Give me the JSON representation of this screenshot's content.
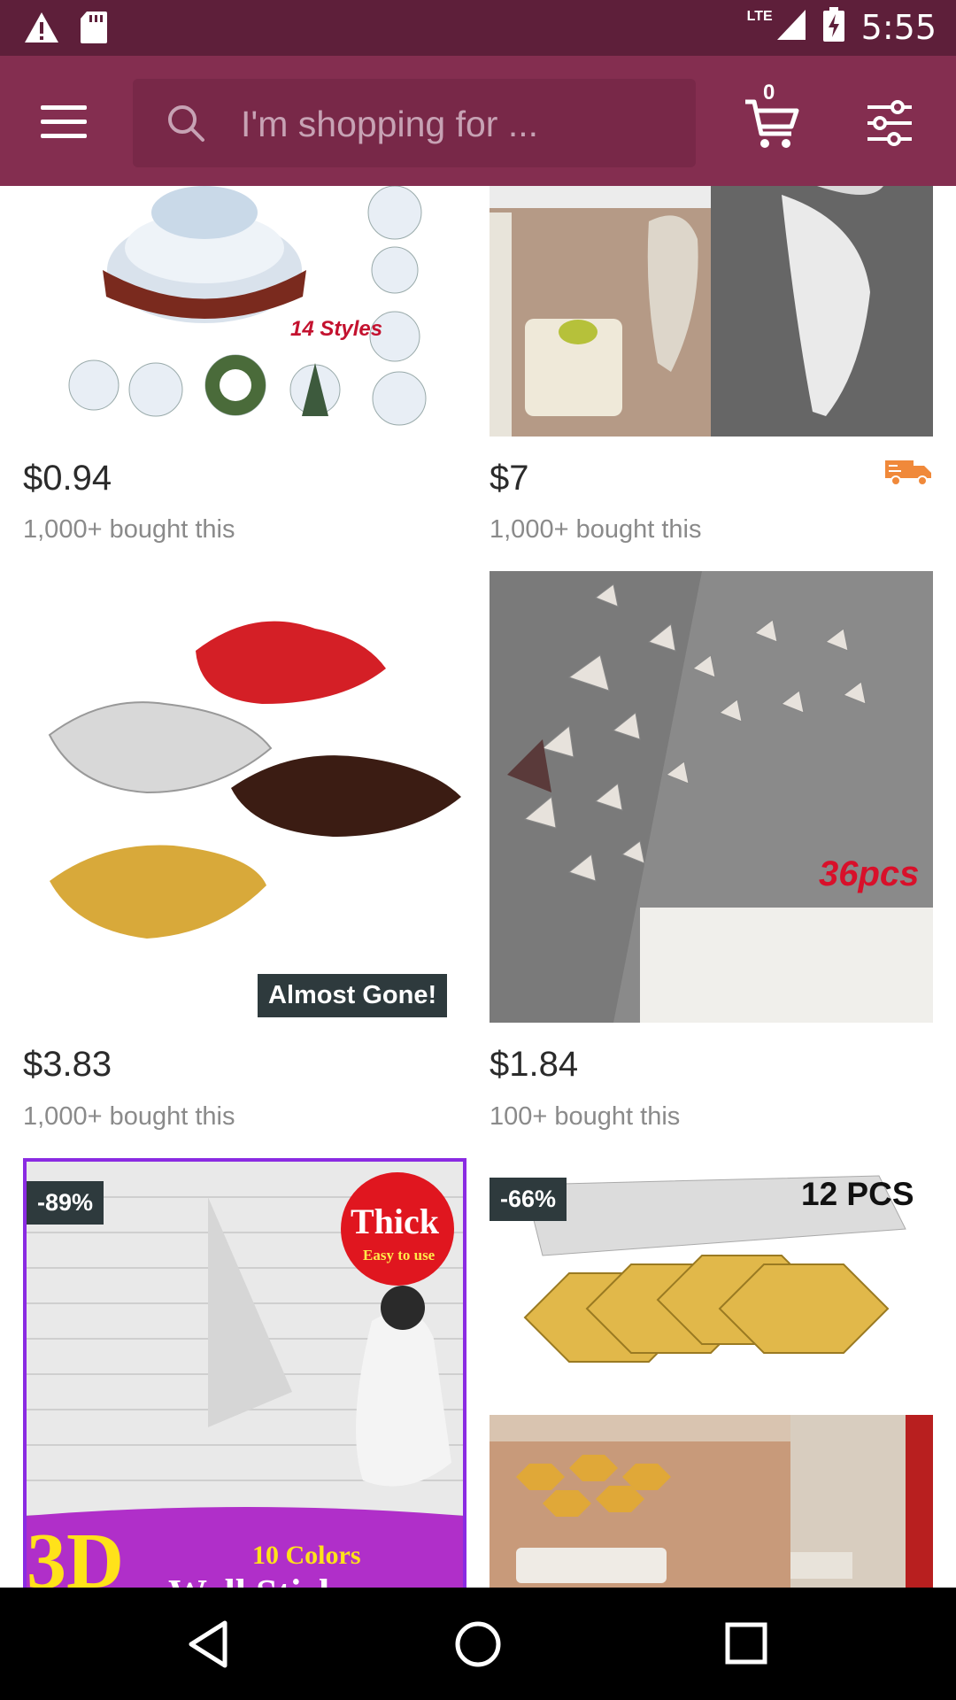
{
  "status_bar": {
    "network_label": "LTE",
    "time": "5:55"
  },
  "app_bar": {
    "search_placeholder": "I'm shopping for ...",
    "cart_count": "0"
  },
  "products": [
    {
      "price": "$0.94",
      "bought": "1,000+ bought this",
      "image_text": "14 Styles"
    },
    {
      "price": "$7",
      "bought": "1,000+ bought this",
      "shipping_icon": "delivery-truck-icon"
    },
    {
      "price": "$3.83",
      "bought": "1,000+ bought this",
      "badge": "Almost Gone!"
    },
    {
      "price": "$1.84",
      "bought": "100+ bought this",
      "image_text": "36pcs"
    },
    {
      "discount": "-89%",
      "image_text_1": "Thick",
      "image_text_2": "Easy to use",
      "image_text_3": "3D",
      "image_text_4": "10 Colors",
      "image_text_5": "Wall Sticker"
    },
    {
      "discount": "-66%",
      "image_text": "12 PCS"
    }
  ],
  "colors": {
    "status_bar": "#5e1f3a",
    "app_bar": "#842e50",
    "search_box": "#782848",
    "badge": "#2e3a3d",
    "shipping_icon": "#f0893a"
  }
}
